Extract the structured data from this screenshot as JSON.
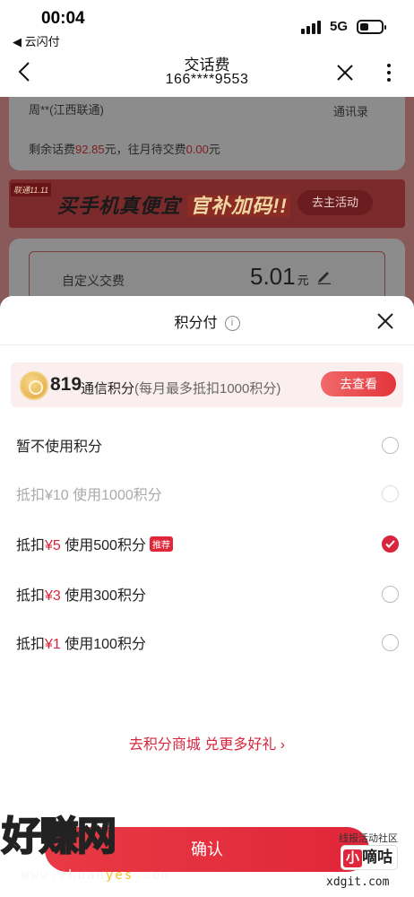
{
  "status_bar": {
    "time": "00:04",
    "back_app": "◀ 云闪付",
    "network": "5G"
  },
  "nav": {
    "title": "交话费",
    "phone": "166****9553"
  },
  "background": {
    "owner": "周**(江西联通)",
    "contacts": "通讯录",
    "balance_prefix": "剩余话费",
    "balance_amount": "92.85",
    "balance_mid": "元，往月待交费",
    "pending_amount": "0.00",
    "balance_suffix": "元",
    "banner": {
      "tag": "联通11.11",
      "text_main": "买手机真便宜",
      "text_highlight": "官补加码!!",
      "button": "去主活动"
    },
    "custom": {
      "label": "自定义交费",
      "amount": "5.01",
      "unit": "元"
    }
  },
  "sheet": {
    "title": "积分付",
    "info_glyph": "i",
    "points": {
      "value": "819",
      "label": "通信积分",
      "note": "(每月最多抵扣1000积分)",
      "button": "去查看"
    },
    "options": [
      {
        "prefix": "暂不使用积分",
        "amount": "",
        "suffix": "",
        "badge": "",
        "state": "unchecked"
      },
      {
        "prefix": "抵扣¥10 使用1000积分",
        "amount": "",
        "suffix": "",
        "badge": "",
        "state": "disabled"
      },
      {
        "prefix": "抵扣",
        "amount": "¥5",
        "suffix": " 使用500积分",
        "badge": "推荐",
        "state": "checked"
      },
      {
        "prefix": "抵扣",
        "amount": "¥3",
        "suffix": " 使用300积分",
        "badge": "",
        "state": "unchecked"
      },
      {
        "prefix": "抵扣",
        "amount": "¥1",
        "suffix": " 使用100积分",
        "badge": "",
        "state": "unchecked"
      }
    ],
    "mall_link": "去积分商城 兑更多好礼",
    "mall_arrow": "›",
    "confirm": "确认"
  },
  "watermarks": {
    "left_logo": "好赚网",
    "left_url_a": "www.zhuan",
    "left_url_b": "yes",
    "left_url_c": ".com",
    "right_top": "线报活动社区",
    "right_logo_a": "小",
    "right_logo_b": "嘀咕",
    "right_url": "xdgit.com"
  },
  "colors": {
    "accent": "#d7263d",
    "button_gradient_start": "#e83a44",
    "sheet_bg": "#ffffff",
    "points_bg": "#fbeeee"
  },
  "icons": [
    "back-arrow-icon",
    "close-icon",
    "more-icon",
    "edit-icon",
    "info-icon",
    "coin-icon",
    "check-icon",
    "chevron-right-icon"
  ]
}
